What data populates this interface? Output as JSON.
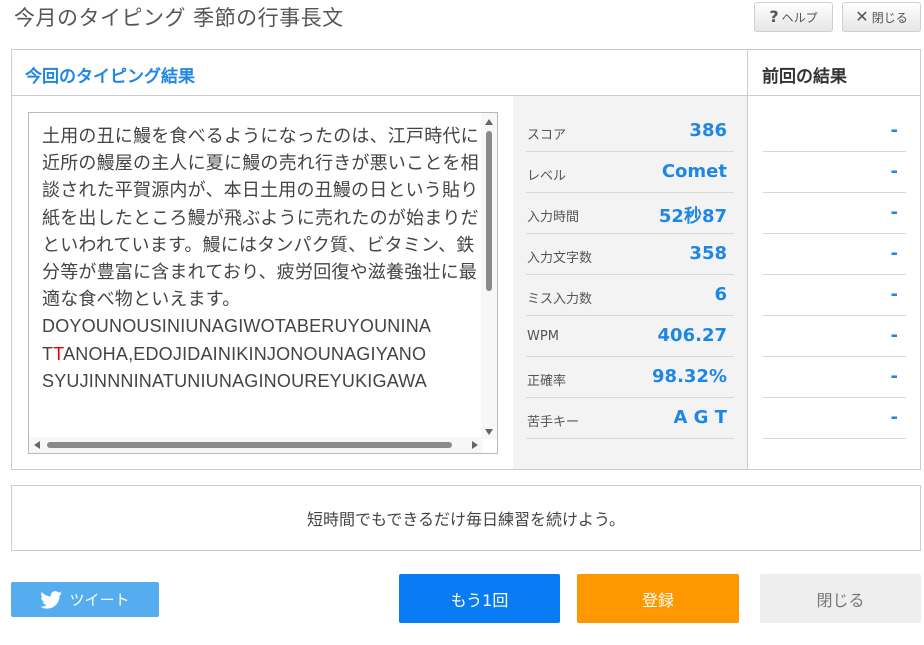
{
  "header": {
    "title": "今月のタイピング 季節の行事長文",
    "help_label": "ヘルプ",
    "close_label": "閉じる"
  },
  "panel": {
    "current_title": "今回のタイピング結果",
    "previous_title": "前回の結果"
  },
  "text": {
    "japanese": "土用の丑に鰻を食べるようになったのは、江戸時代に近所の鰻屋の主人に夏に鰻の売れ行きが悪いことを相談された平賀源内が、本日土用の丑鰻の日という貼り紙を出したところ鰻が飛ぶように売れたのが始まりだといわれています。鰻にはタンパク質、ビタミン、鉄分等が豊富に含まれており、疲労回復や滋養強壮に最適な食べ物といえます。",
    "romaji_line1": "DOYOUNOUSINIUNAGIWOTABERUYOUNINA",
    "romaji_line2_pre": "T",
    "romaji_line2_miss": "T",
    "romaji_line2_post": "ANOHA,EDOJIDAINIKINJONOUNAGIYANO",
    "romaji_line3": "SYUJINNNINATUNIUNAGINOUREYUKIGAWA"
  },
  "stats": [
    {
      "label": "スコア",
      "value": "386",
      "previous": "-"
    },
    {
      "label": "レベル",
      "value": "Comet",
      "previous": "-"
    },
    {
      "label": "入力時間",
      "value": "52秒87",
      "previous": "-"
    },
    {
      "label": "入力文字数",
      "value": "358",
      "previous": "-"
    },
    {
      "label": "ミス入力数",
      "value": "6",
      "previous": "-"
    },
    {
      "label": "WPM",
      "value": "406.27",
      "previous": "-"
    },
    {
      "label": "正確率",
      "value": "98.32%",
      "previous": "-"
    },
    {
      "label": "苦手キー",
      "value": "A G T",
      "previous": "-"
    }
  ],
  "message": "短時間でもできるだけ毎日練習を続けよう。",
  "buttons": {
    "tweet": "ツイート",
    "retry": "もう1回",
    "register": "登録",
    "close": "閉じる"
  },
  "colors": {
    "accent": "#1e87e5",
    "retry": "#0a7cf3",
    "register": "#ff9800",
    "tweet": "#55acee",
    "miss": "#e60000"
  },
  "icons": {
    "help": "question-mark",
    "close": "x-mark",
    "tweet": "twitter-bird"
  }
}
